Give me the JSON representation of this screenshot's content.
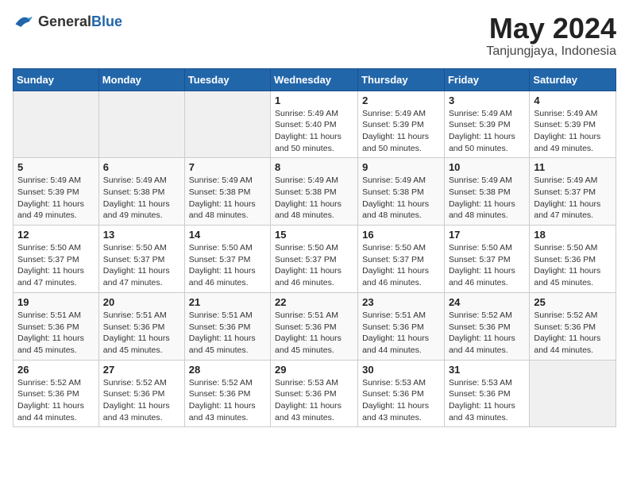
{
  "logo": {
    "general": "General",
    "blue": "Blue"
  },
  "header": {
    "month": "May 2024",
    "location": "Tanjungjaya, Indonesia"
  },
  "weekdays": [
    "Sunday",
    "Monday",
    "Tuesday",
    "Wednesday",
    "Thursday",
    "Friday",
    "Saturday"
  ],
  "weeks": [
    [
      {
        "day": "",
        "info": ""
      },
      {
        "day": "",
        "info": ""
      },
      {
        "day": "",
        "info": ""
      },
      {
        "day": "1",
        "info": "Sunrise: 5:49 AM\nSunset: 5:40 PM\nDaylight: 11 hours\nand 50 minutes."
      },
      {
        "day": "2",
        "info": "Sunrise: 5:49 AM\nSunset: 5:39 PM\nDaylight: 11 hours\nand 50 minutes."
      },
      {
        "day": "3",
        "info": "Sunrise: 5:49 AM\nSunset: 5:39 PM\nDaylight: 11 hours\nand 50 minutes."
      },
      {
        "day": "4",
        "info": "Sunrise: 5:49 AM\nSunset: 5:39 PM\nDaylight: 11 hours\nand 49 minutes."
      }
    ],
    [
      {
        "day": "5",
        "info": "Sunrise: 5:49 AM\nSunset: 5:39 PM\nDaylight: 11 hours\nand 49 minutes."
      },
      {
        "day": "6",
        "info": "Sunrise: 5:49 AM\nSunset: 5:38 PM\nDaylight: 11 hours\nand 49 minutes."
      },
      {
        "day": "7",
        "info": "Sunrise: 5:49 AM\nSunset: 5:38 PM\nDaylight: 11 hours\nand 48 minutes."
      },
      {
        "day": "8",
        "info": "Sunrise: 5:49 AM\nSunset: 5:38 PM\nDaylight: 11 hours\nand 48 minutes."
      },
      {
        "day": "9",
        "info": "Sunrise: 5:49 AM\nSunset: 5:38 PM\nDaylight: 11 hours\nand 48 minutes."
      },
      {
        "day": "10",
        "info": "Sunrise: 5:49 AM\nSunset: 5:38 PM\nDaylight: 11 hours\nand 48 minutes."
      },
      {
        "day": "11",
        "info": "Sunrise: 5:49 AM\nSunset: 5:37 PM\nDaylight: 11 hours\nand 47 minutes."
      }
    ],
    [
      {
        "day": "12",
        "info": "Sunrise: 5:50 AM\nSunset: 5:37 PM\nDaylight: 11 hours\nand 47 minutes."
      },
      {
        "day": "13",
        "info": "Sunrise: 5:50 AM\nSunset: 5:37 PM\nDaylight: 11 hours\nand 47 minutes."
      },
      {
        "day": "14",
        "info": "Sunrise: 5:50 AM\nSunset: 5:37 PM\nDaylight: 11 hours\nand 46 minutes."
      },
      {
        "day": "15",
        "info": "Sunrise: 5:50 AM\nSunset: 5:37 PM\nDaylight: 11 hours\nand 46 minutes."
      },
      {
        "day": "16",
        "info": "Sunrise: 5:50 AM\nSunset: 5:37 PM\nDaylight: 11 hours\nand 46 minutes."
      },
      {
        "day": "17",
        "info": "Sunrise: 5:50 AM\nSunset: 5:37 PM\nDaylight: 11 hours\nand 46 minutes."
      },
      {
        "day": "18",
        "info": "Sunrise: 5:50 AM\nSunset: 5:36 PM\nDaylight: 11 hours\nand 45 minutes."
      }
    ],
    [
      {
        "day": "19",
        "info": "Sunrise: 5:51 AM\nSunset: 5:36 PM\nDaylight: 11 hours\nand 45 minutes."
      },
      {
        "day": "20",
        "info": "Sunrise: 5:51 AM\nSunset: 5:36 PM\nDaylight: 11 hours\nand 45 minutes."
      },
      {
        "day": "21",
        "info": "Sunrise: 5:51 AM\nSunset: 5:36 PM\nDaylight: 11 hours\nand 45 minutes."
      },
      {
        "day": "22",
        "info": "Sunrise: 5:51 AM\nSunset: 5:36 PM\nDaylight: 11 hours\nand 45 minutes."
      },
      {
        "day": "23",
        "info": "Sunrise: 5:51 AM\nSunset: 5:36 PM\nDaylight: 11 hours\nand 44 minutes."
      },
      {
        "day": "24",
        "info": "Sunrise: 5:52 AM\nSunset: 5:36 PM\nDaylight: 11 hours\nand 44 minutes."
      },
      {
        "day": "25",
        "info": "Sunrise: 5:52 AM\nSunset: 5:36 PM\nDaylight: 11 hours\nand 44 minutes."
      }
    ],
    [
      {
        "day": "26",
        "info": "Sunrise: 5:52 AM\nSunset: 5:36 PM\nDaylight: 11 hours\nand 44 minutes."
      },
      {
        "day": "27",
        "info": "Sunrise: 5:52 AM\nSunset: 5:36 PM\nDaylight: 11 hours\nand 43 minutes."
      },
      {
        "day": "28",
        "info": "Sunrise: 5:52 AM\nSunset: 5:36 PM\nDaylight: 11 hours\nand 43 minutes."
      },
      {
        "day": "29",
        "info": "Sunrise: 5:53 AM\nSunset: 5:36 PM\nDaylight: 11 hours\nand 43 minutes."
      },
      {
        "day": "30",
        "info": "Sunrise: 5:53 AM\nSunset: 5:36 PM\nDaylight: 11 hours\nand 43 minutes."
      },
      {
        "day": "31",
        "info": "Sunrise: 5:53 AM\nSunset: 5:36 PM\nDaylight: 11 hours\nand 43 minutes."
      },
      {
        "day": "",
        "info": ""
      }
    ]
  ]
}
